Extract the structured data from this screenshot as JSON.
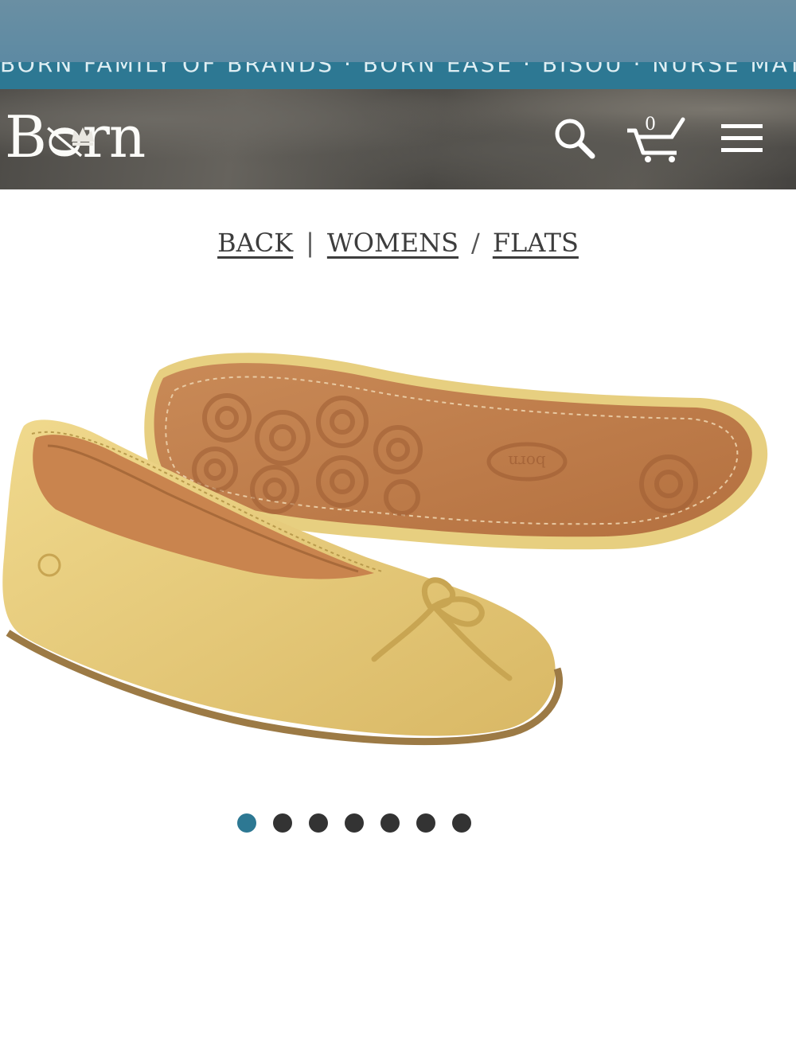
{
  "promo_text": "BORN FAMILY OF BRANDS   ·   BORN EASE   ·   BISOU   ·   NURSE MATES",
  "brand": {
    "logo_text": "Bᴓrn"
  },
  "header": {
    "cart_count": "0"
  },
  "breadcrumb": {
    "back": "BACK",
    "sep1": "|",
    "womens": "WOMENS",
    "sep2": "/",
    "flats": "FLATS"
  },
  "gallery": {
    "total_images": 7,
    "active_index": 0
  },
  "colors": {
    "promo": "#2d7893",
    "active_dot": "#2d7893",
    "inactive_dot": "#333333",
    "shoe_suede": "#e6c97a",
    "sole": "#c07a46"
  },
  "sole_emboss": "born"
}
